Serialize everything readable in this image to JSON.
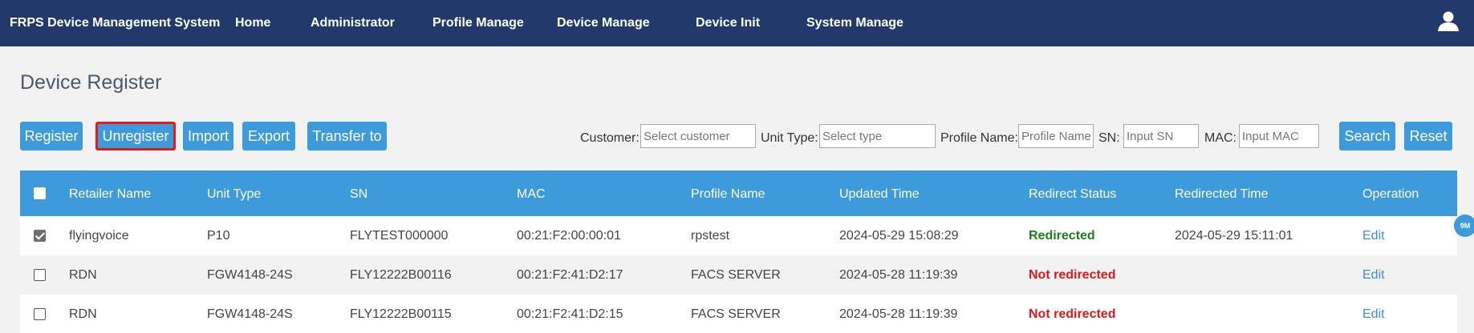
{
  "navbar": {
    "brand": "FRPS Device Management System",
    "items": [
      {
        "label": "Home"
      },
      {
        "label": "Administrator"
      },
      {
        "label": "Profile Manage"
      },
      {
        "label": "Device Manage"
      },
      {
        "label": "Device Init"
      },
      {
        "label": "System Manage"
      }
    ],
    "user_icon": "user-icon"
  },
  "page": {
    "title": "Device Register"
  },
  "toolbar": {
    "register": "Register",
    "unregister": "Unregister",
    "import": "Import",
    "export": "Export",
    "transfer": "Transfer to"
  },
  "filters": {
    "customer": {
      "label": "Customer:",
      "placeholder": "Select customer"
    },
    "unit_type": {
      "label": "Unit Type:",
      "placeholder": "Select type"
    },
    "profile_name": {
      "label": "Profile Name:",
      "placeholder": "Profile Name"
    },
    "sn": {
      "label": "SN:",
      "placeholder": "Input SN"
    },
    "mac": {
      "label": "MAC:",
      "placeholder": "Input MAC"
    },
    "search": "Search",
    "reset": "Reset"
  },
  "table": {
    "columns": [
      "Retailer Name",
      "Unit Type",
      "SN",
      "MAC",
      "Profile Name",
      "Updated Time",
      "Redirect Status",
      "Redirected Time",
      "Operation"
    ],
    "rows": [
      {
        "checked": true,
        "retailer": "flyingvoice",
        "unit_type": "P10",
        "sn": "FLYTEST000000",
        "mac": "00:21:F2:00:00:01",
        "profile": "rpstest",
        "updated": "2024-05-29 15:08:29",
        "status": "Redirected",
        "redirected_time": "2024-05-29 15:11:01",
        "operation": "Edit"
      },
      {
        "checked": false,
        "retailer": "RDN",
        "unit_type": "FGW4148-24S",
        "sn": "FLY12222B00116",
        "mac": "00:21:F2:41:D2:17",
        "profile": "FACS SERVER",
        "updated": "2024-05-28 11:19:39",
        "status": "Not redirected",
        "redirected_time": "",
        "operation": "Edit"
      },
      {
        "checked": false,
        "retailer": "RDN",
        "unit_type": "FGW4148-24S",
        "sn": "FLY12222B00115",
        "mac": "00:21:F2:41:D2:15",
        "profile": "FACS SERVER",
        "updated": "2024-05-28 11:19:39",
        "status": "Not redirected",
        "redirected_time": "",
        "operation": "Edit"
      }
    ]
  },
  "floating_badge": "9M",
  "colors": {
    "navbar": "#213a6b",
    "accent": "#3d9bdb",
    "redirected": "#1a7f1a",
    "not_redirected": "#e01818",
    "highlight_border": "#e21a1a"
  }
}
